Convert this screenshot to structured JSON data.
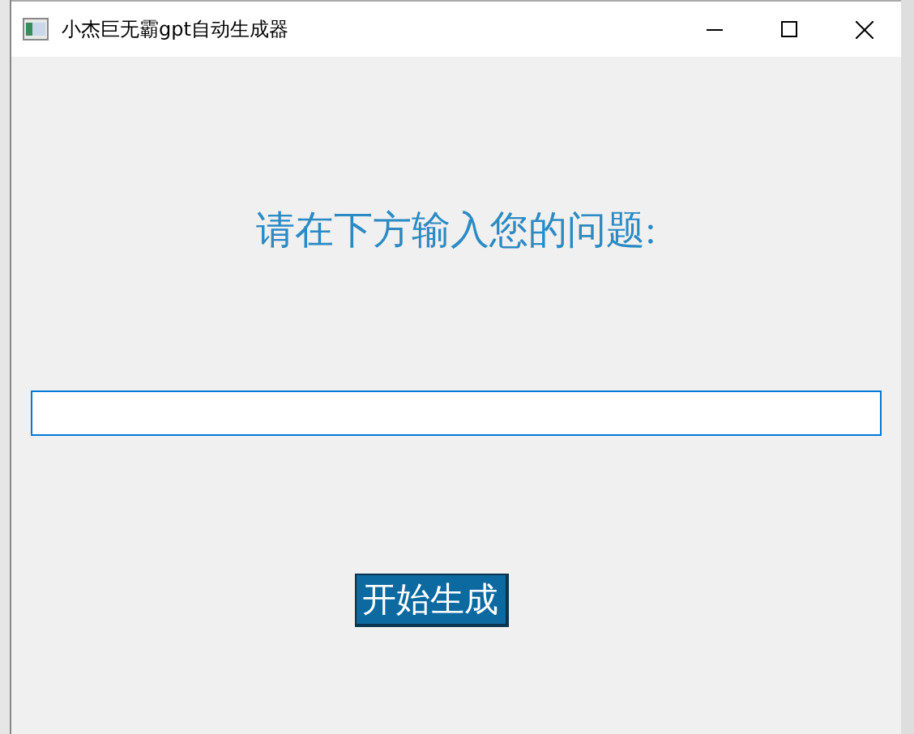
{
  "window": {
    "title": "小杰巨无霸gpt自动生成器"
  },
  "prompt": "请在下方输入您的问题:",
  "buttons": [
    {
      "label": "开始生成"
    }
  ]
}
